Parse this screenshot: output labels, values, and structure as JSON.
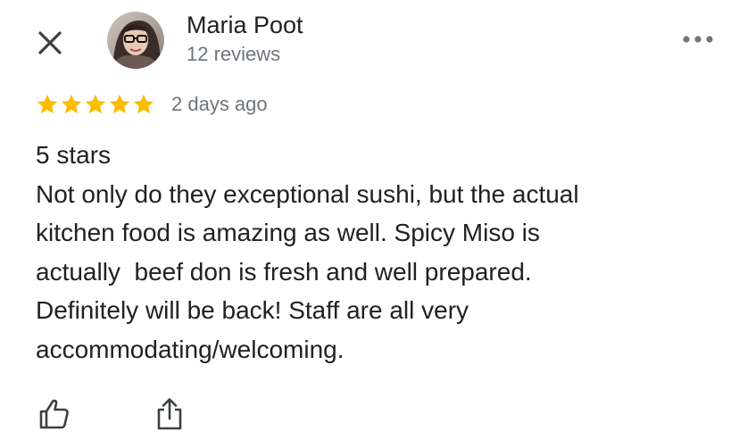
{
  "header": {
    "close_icon": "close-icon",
    "more_icon": "more-horizontal-icon"
  },
  "reviewer": {
    "name": "Maria Poot",
    "reviews_count": "12 reviews",
    "avatar": "user-avatar"
  },
  "review": {
    "rating": 5,
    "rating_max": 5,
    "star_color": "#fbbc04",
    "date": "2 days ago",
    "title_line": "5 stars",
    "lines": [
      "Not only do they exceptional sushi, but the actual",
      "kitchen food is amazing as well. Spicy Miso is",
      "actually  beef don is fresh and well prepared.",
      "Definitely will be back! Staff are all very",
      "accommodating/welcoming."
    ]
  },
  "actions": {
    "like_icon": "thumbs-up-icon",
    "share_icon": "share-icon"
  },
  "colors": {
    "primary_text": "#202124",
    "secondary_text": "#70757a",
    "icon": "#3c4043",
    "star": "#fbbc04"
  }
}
